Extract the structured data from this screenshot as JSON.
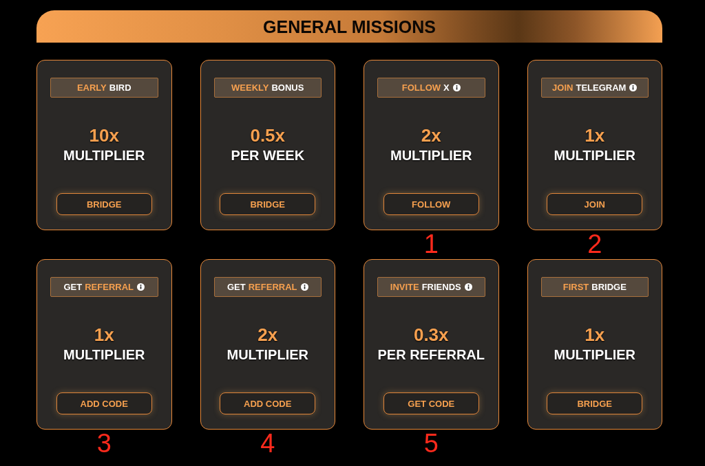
{
  "header": {
    "title": "GENERAL MISSIONS"
  },
  "missions": [
    {
      "tag": [
        {
          "text": "EARLY",
          "highlighted": true
        },
        {
          "text": "BIRD",
          "highlighted": false
        }
      ],
      "info": false,
      "value": "10x",
      "label": "MULTIPLIER",
      "button": "BRIDGE"
    },
    {
      "tag": [
        {
          "text": "WEEKLY",
          "highlighted": true
        },
        {
          "text": "BONUS",
          "highlighted": false
        }
      ],
      "info": false,
      "value": "0.5x",
      "label": "PER WEEK",
      "button": "BRIDGE"
    },
    {
      "tag": [
        {
          "text": "FOLLOW",
          "highlighted": true
        },
        {
          "text": "X",
          "highlighted": false
        }
      ],
      "info": true,
      "value": "2x",
      "label": "MULTIPLIER",
      "button": "FOLLOW",
      "annotation": "1"
    },
    {
      "tag": [
        {
          "text": "JOIN",
          "highlighted": true
        },
        {
          "text": "TELEGRAM",
          "highlighted": false
        }
      ],
      "info": true,
      "value": "1x",
      "label": "MULTIPLIER",
      "button": "JOIN",
      "annotation": "2"
    },
    {
      "tag": [
        {
          "text": "GET",
          "highlighted": false
        },
        {
          "text": "REFERRAL",
          "highlighted": true
        }
      ],
      "info": true,
      "value": "1x",
      "label": "MULTIPLIER",
      "button": "ADD CODE",
      "annotation": "3"
    },
    {
      "tag": [
        {
          "text": "GET",
          "highlighted": false
        },
        {
          "text": "REFERRAL",
          "highlighted": true
        }
      ],
      "info": true,
      "value": "2x",
      "label": "MULTIPLIER",
      "button": "ADD CODE",
      "annotation": "4"
    },
    {
      "tag": [
        {
          "text": "INVITE",
          "highlighted": true
        },
        {
          "text": "FRIENDS",
          "highlighted": false
        }
      ],
      "info": true,
      "value": "0.3x",
      "label": "PER REFERRAL",
      "button": "GET CODE",
      "annotation": "5"
    },
    {
      "tag": [
        {
          "text": "FIRST",
          "highlighted": true
        },
        {
          "text": "BRIDGE",
          "highlighted": false
        }
      ],
      "info": false,
      "value": "1x",
      "label": "MULTIPLIER",
      "button": "BRIDGE"
    }
  ]
}
